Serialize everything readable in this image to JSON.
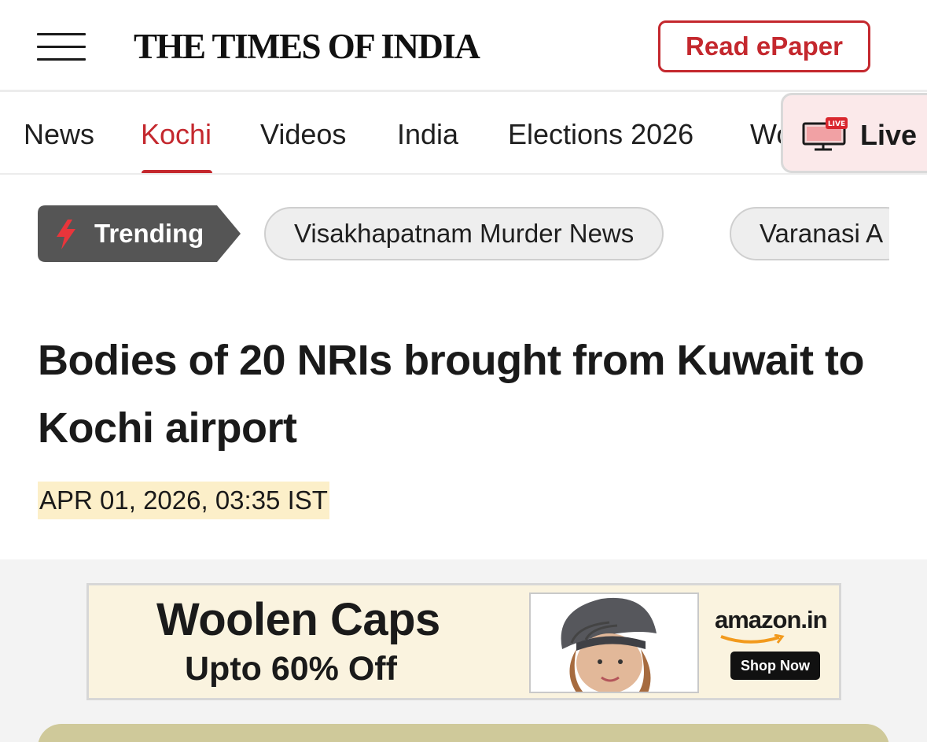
{
  "header": {
    "logo": "THE TIMES OF INDIA",
    "epaper_label": "Read ePaper"
  },
  "nav": {
    "items": [
      {
        "label": "News"
      },
      {
        "label": "Kochi",
        "active": true
      },
      {
        "label": "Videos"
      },
      {
        "label": "India"
      },
      {
        "label": "Elections 2026"
      },
      {
        "label": "Wo"
      }
    ],
    "live_label": "Live",
    "live_badge": "LIVE"
  },
  "trending": {
    "label": "Trending",
    "pills": [
      "Visakhapatnam Murder News",
      "Varanasi A"
    ]
  },
  "article": {
    "headline": "Bodies of 20 NRIs brought from Kuwait to Kochi airport",
    "dateline": "APR 01, 2026, 03:35 IST"
  },
  "ad": {
    "title": "Woolen Caps",
    "subtitle": "Upto 60% Off",
    "brand": "amazon.in",
    "cta": "Shop Now"
  },
  "colors": {
    "accent": "#c4282e",
    "trending_bg": "#555555",
    "date_highlight": "#fcefc9",
    "live_bg": "#fbe9ea"
  },
  "icons": {
    "menu": "hamburger-icon",
    "live": "live-tv-icon",
    "trending": "flash-icon"
  }
}
